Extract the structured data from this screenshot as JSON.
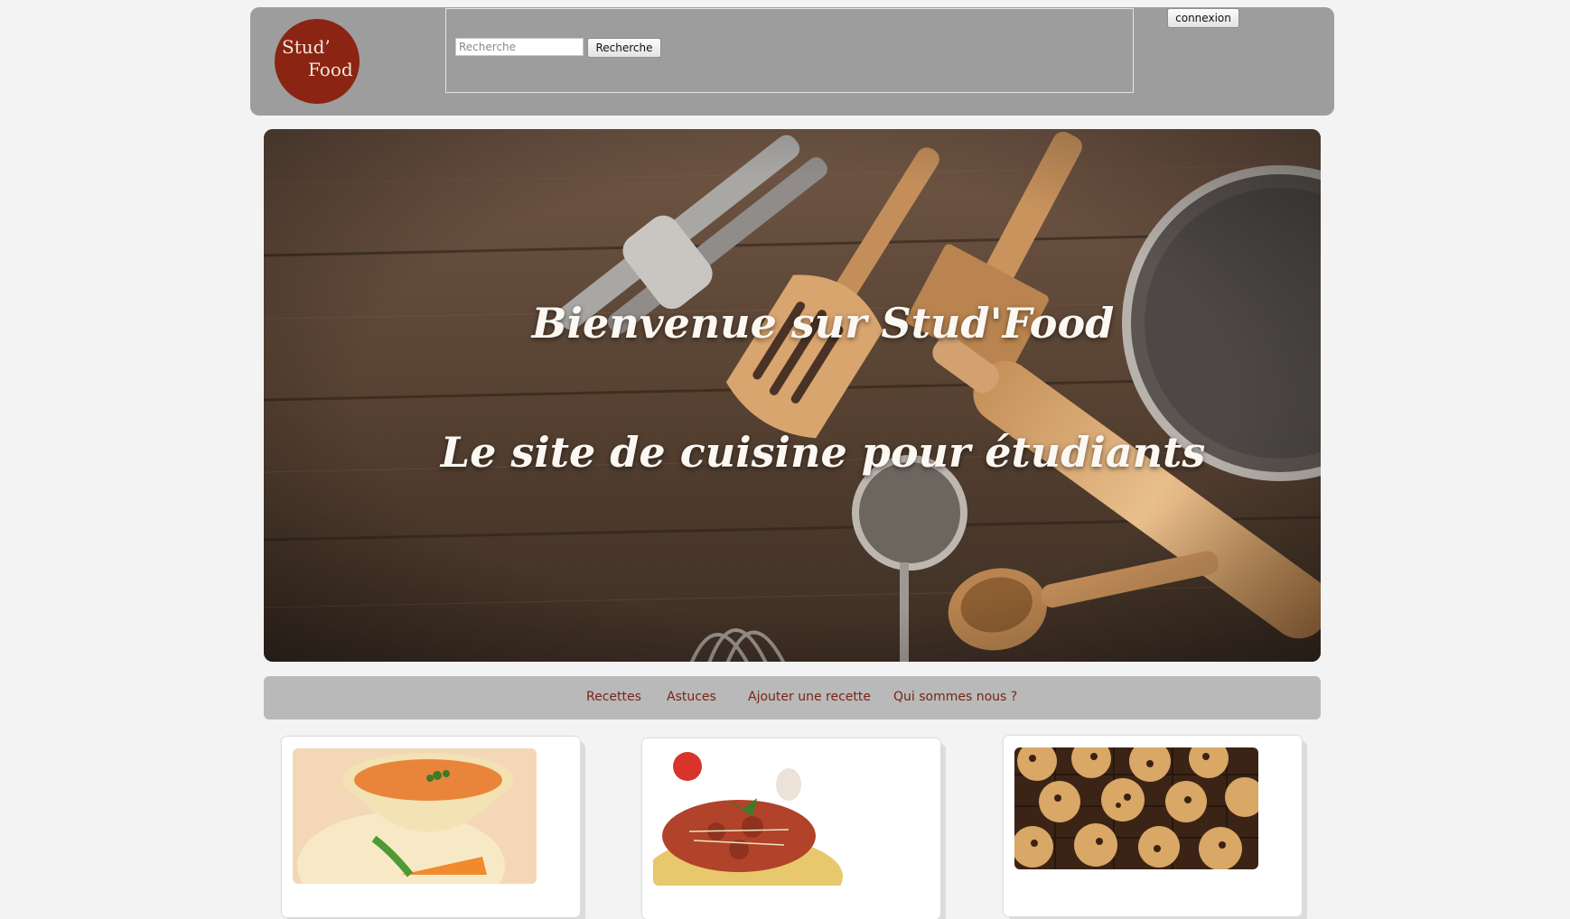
{
  "header": {
    "logo_line1": "Stud’",
    "logo_line2": "Food",
    "search_placeholder": "Recherche",
    "search_button": "Recherche",
    "login_button": "connexion"
  },
  "hero": {
    "title": "Bienvenue sur Stud'Food",
    "subtitle": "Le site de cuisine pour étudiants"
  },
  "nav": {
    "items": [
      "Recettes",
      "Astuces",
      "Ajouter une recette",
      "Qui sommes nous ?"
    ]
  },
  "cards": [
    {
      "image": "carrot-soup-image"
    },
    {
      "image": "spaghetti-bolognese-image"
    },
    {
      "image": "chocolate-chip-cookies-image"
    }
  ],
  "colors": {
    "header_bg": "#9d9d9d",
    "logo_bg": "#8b2412",
    "nav_bg": "#b9b9b9",
    "nav_text": "#7a2414",
    "page_bg": "#f3f3f3"
  }
}
